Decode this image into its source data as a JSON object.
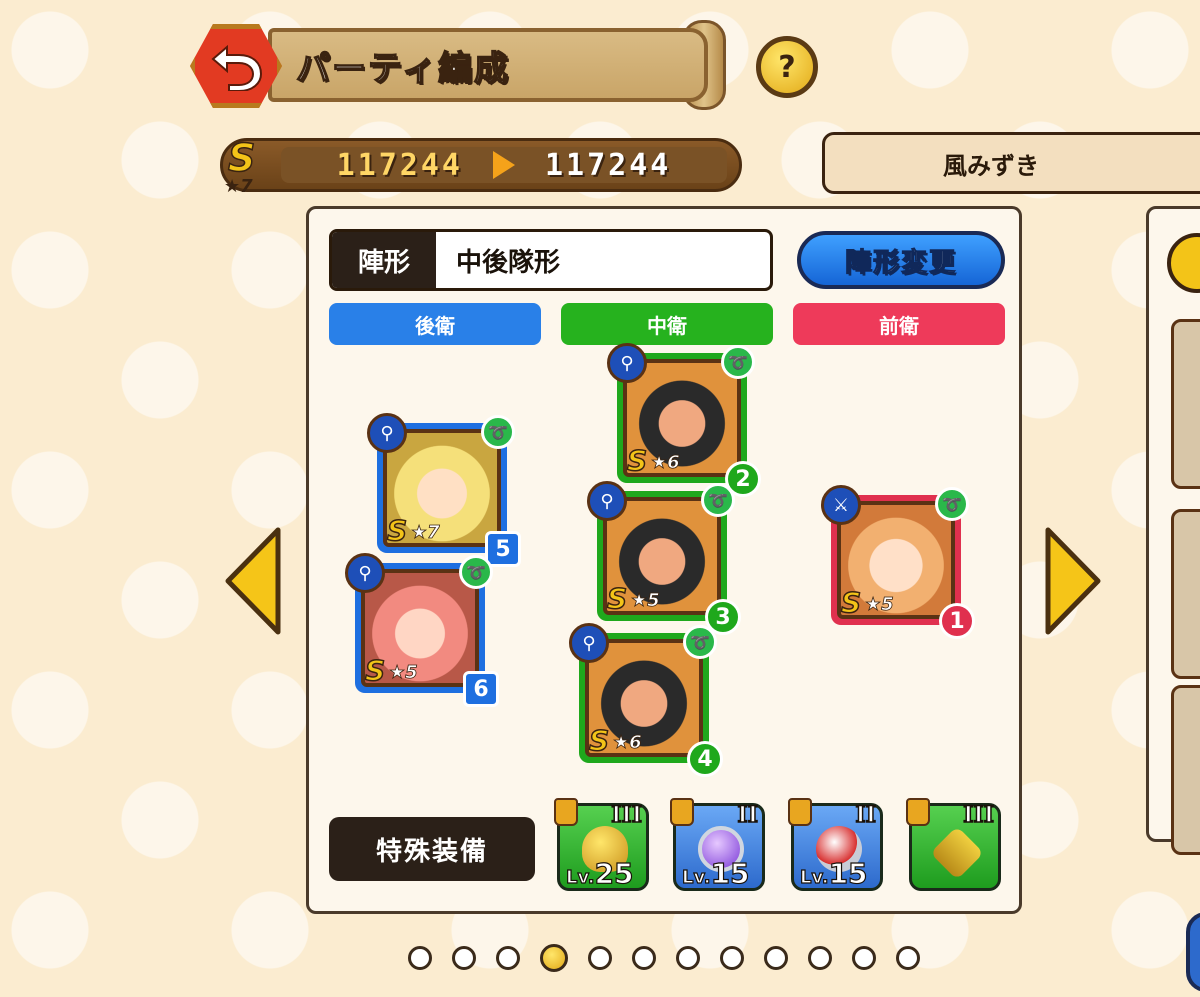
{
  "header": {
    "title": "パーティ編成",
    "help_label": "?"
  },
  "power": {
    "rank_letter": "S",
    "rank_stars": "★7",
    "before": "117244",
    "after": "117244"
  },
  "user_name": "風みずき",
  "formation": {
    "label": "陣形",
    "value": "中後隊形",
    "change_button": "陣形変更"
  },
  "positions": {
    "back": "後衛",
    "middle": "中衛",
    "front": "前衛"
  },
  "units": [
    {
      "order": "5",
      "rank": "S",
      "stars": "★7",
      "position": "back",
      "weapon_icon": "staff-icon",
      "element_icon": "wind-icon"
    },
    {
      "order": "6",
      "rank": "S",
      "stars": "★5",
      "position": "back",
      "weapon_icon": "staff-icon",
      "element_icon": "wind-icon"
    },
    {
      "order": "2",
      "rank": "S",
      "stars": "★6",
      "position": "middle",
      "weapon_icon": "staff-icon",
      "element_icon": "wind-icon"
    },
    {
      "order": "3",
      "rank": "S",
      "stars": "★5",
      "position": "middle",
      "weapon_icon": "staff-icon",
      "element_icon": "wind-icon"
    },
    {
      "order": "4",
      "rank": "S",
      "stars": "★6",
      "position": "middle",
      "weapon_icon": "staff-icon",
      "element_icon": "wind-icon"
    },
    {
      "order": "1",
      "rank": "S",
      "stars": "★5",
      "position": "front",
      "weapon_icon": "axe-icon",
      "element_icon": "wind-icon"
    }
  ],
  "special_equipment": {
    "label": "特殊装備",
    "items": [
      {
        "grade": "III",
        "level_prefix": "Lv.",
        "level": "25",
        "color": "#1e9c1e",
        "icon": "ring-icon"
      },
      {
        "grade": "II",
        "level_prefix": "Lv.",
        "level": "15",
        "color": "#2d6acc",
        "icon": "ring-icon"
      },
      {
        "grade": "II",
        "level_prefix": "Lv.",
        "level": "15",
        "color": "#2d6acc",
        "icon": "amulet-icon"
      },
      {
        "grade": "III",
        "level_prefix": "",
        "level": "",
        "color": "#1e9c1e",
        "icon": "pendant-icon"
      }
    ]
  },
  "pagination": {
    "total": 12,
    "current": 4
  }
}
